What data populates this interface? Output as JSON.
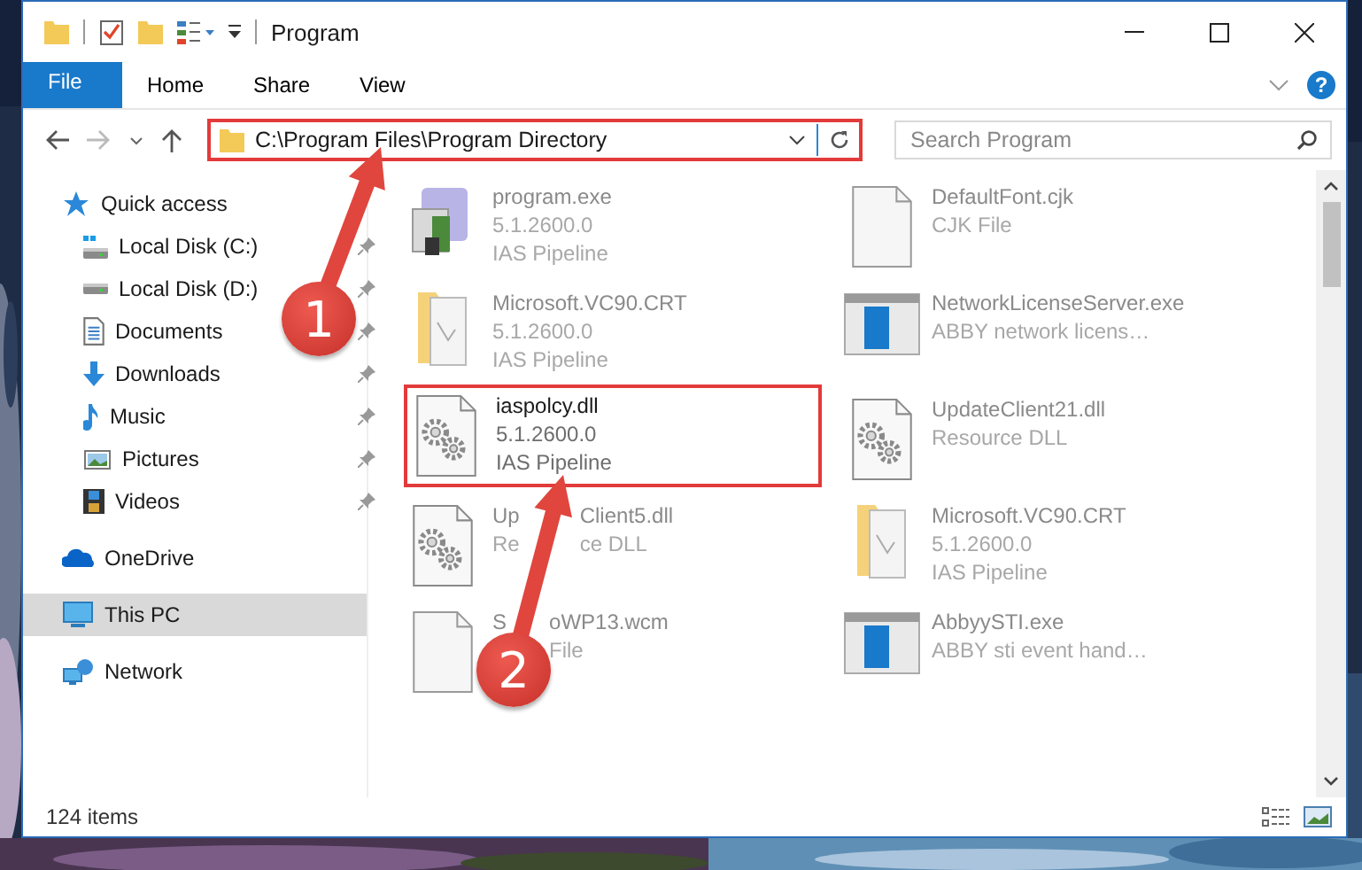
{
  "window": {
    "title": "Program"
  },
  "ribbon": {
    "tabs": [
      {
        "label": "File",
        "kind": "file"
      },
      {
        "label": "Home",
        "kind": "tab"
      },
      {
        "label": "Share",
        "kind": "tab"
      },
      {
        "label": "View",
        "kind": "tab"
      }
    ],
    "help": "?"
  },
  "address_bar": {
    "path": "C:\\Program Files\\Program Directory",
    "search_placeholder": "Search Program"
  },
  "sidebar": {
    "items": [
      {
        "label": "Quick access",
        "kind": "star",
        "selected": false,
        "children": [
          {
            "label": "Local Disk (C:)",
            "kind": "systemdrive",
            "pinned": true,
            "selected": false
          },
          {
            "label": "Local Disk (D:)",
            "kind": "drive",
            "pinned": true,
            "selected": false
          },
          {
            "label": "Documents",
            "kind": "documents",
            "pinned": true,
            "selected": false
          },
          {
            "label": "Downloads",
            "kind": "downloads",
            "pinned": true,
            "selected": false
          },
          {
            "label": "Music",
            "kind": "music",
            "pinned": true,
            "selected": false
          },
          {
            "label": "Pictures",
            "kind": "pictures",
            "pinned": true,
            "selected": false
          },
          {
            "label": "Videos",
            "kind": "videos",
            "pinned": true,
            "selected": false
          }
        ]
      },
      {
        "label": "OneDrive",
        "kind": "cloud",
        "selected": false
      },
      {
        "label": "This PC",
        "kind": "computer",
        "selected": true
      },
      {
        "label": "Network",
        "kind": "network",
        "selected": false
      }
    ]
  },
  "files": [
    {
      "name": "program.exe",
      "lines": [
        "5.1.2600.0",
        "IAS Pipeline"
      ],
      "kind": "exe",
      "highlighted": false
    },
    {
      "name": "DefaultFont.cjk",
      "lines": [
        "CJK File"
      ],
      "kind": "blank",
      "highlighted": false
    },
    {
      "name": "Microsoft.VC90.CRT",
      "lines": [
        "5.1.2600.0",
        "IAS Pipeline"
      ],
      "kind": "folder",
      "highlighted": false
    },
    {
      "name": "NetworkLicenseServer.exe",
      "lines": [
        "ABBY network licens…"
      ],
      "kind": "app",
      "highlighted": false
    },
    {
      "name": "iaspolcy.dll",
      "lines": [
        "5.1.2600.0",
        "IAS Pipeline"
      ],
      "kind": "dll",
      "highlighted": true
    },
    {
      "name": "UpdateClient21.dll",
      "lines": [
        "Resource DLL"
      ],
      "kind": "dll",
      "highlighted": false
    },
    {
      "name": [
        "Up",
        "Client5.dll"
      ],
      "lines": [
        [
          "Re",
          "ce DLL"
        ]
      ],
      "kind": "dll",
      "highlighted": false
    },
    {
      "name": "Microsoft.VC90.CRT",
      "lines": [
        "5.1.2600.0",
        "IAS Pipeline"
      ],
      "kind": "folder",
      "highlighted": false
    },
    {
      "name": [
        "S",
        "oWP13.wcm"
      ],
      "lines": [
        [
          "File"
        ]
      ],
      "kind": "blank",
      "highlighted": false
    },
    {
      "name": "AbbyySTI.exe",
      "lines": [
        "ABBY sti event hand…"
      ],
      "kind": "app",
      "highlighted": false
    }
  ],
  "status_bar": {
    "count": "124 items"
  },
  "annotations": [
    {
      "label": "1"
    },
    {
      "label": "2"
    }
  ]
}
